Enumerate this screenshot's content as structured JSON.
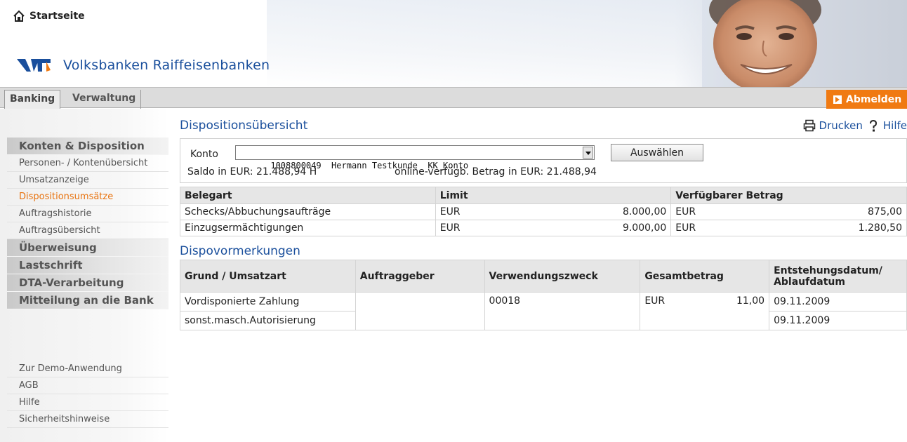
{
  "header": {
    "home_label": "Startseite",
    "brand_name": "Volksbanken Raiffeisenbanken",
    "brand_color": "#1a4f9c",
    "accent_color": "#f07a12"
  },
  "nav": {
    "tabs": [
      {
        "label": "Banking"
      },
      {
        "label": "Verwaltung"
      }
    ],
    "logout_label": "Abmelden"
  },
  "sidebar": {
    "konten_head": "Konten & Disposition",
    "items": [
      {
        "label": "Personen- / Kontenübersicht"
      },
      {
        "label": "Umsatzanzeige"
      },
      {
        "label": "Dispositionsumsätze"
      },
      {
        "label": "Auftragshistorie"
      },
      {
        "label": "Auftragsübersicht"
      }
    ],
    "heads": [
      {
        "label": "Überweisung"
      },
      {
        "label": "Lastschrift"
      },
      {
        "label": "DTA-Verarbeitung"
      },
      {
        "label": "Mitteilung an die Bank"
      }
    ],
    "bottom_links": [
      {
        "label": "Zur Demo-Anwendung"
      },
      {
        "label": "AGB"
      },
      {
        "label": "Hilfe"
      },
      {
        "label": "Sicherheitshinweise"
      }
    ]
  },
  "main": {
    "title": "Dispositionsübersicht",
    "print_label": "Drucken",
    "help_label": "Hilfe",
    "konto_label": "Konto",
    "konto_value": "1008800049  Hermann Testkunde  KK_Konto",
    "select_button": "Auswählen",
    "saldo": "Saldo in EUR: 21.488,94 H",
    "online_available": "online-verfügb. Betrag in EUR: 21.488,94"
  },
  "limits_table": {
    "headers": [
      "Belegart",
      "Limit",
      "Verfügbarer Betrag"
    ],
    "rows": [
      {
        "belegart": "Schecks/Abbuchungsaufträge",
        "limit_currency": "EUR",
        "limit_amount": "8.000,00",
        "avail_currency": "EUR",
        "avail_amount": "875,00"
      },
      {
        "belegart": "Einzugsermächtigungen",
        "limit_currency": "EUR",
        "limit_amount": "9.000,00",
        "avail_currency": "EUR",
        "avail_amount": "1.280,50"
      }
    ]
  },
  "dispo": {
    "title": "Dispovormerkungen",
    "headers": [
      "Grund / Umsatzart",
      "Auftraggeber",
      "Verwendungszweck",
      "Gesamtbetrag",
      "Entstehungsdatum/",
      "Ablaufdatum"
    ],
    "rows": [
      {
        "grund": "Vordisponierte Zahlung",
        "auftraggeber": "",
        "zweck": "00018",
        "currency": "EUR",
        "amount": "11,00",
        "date": "09.11.2009"
      },
      {
        "grund": "sonst.masch.Autorisierung",
        "date": "09.11.2009"
      }
    ]
  }
}
